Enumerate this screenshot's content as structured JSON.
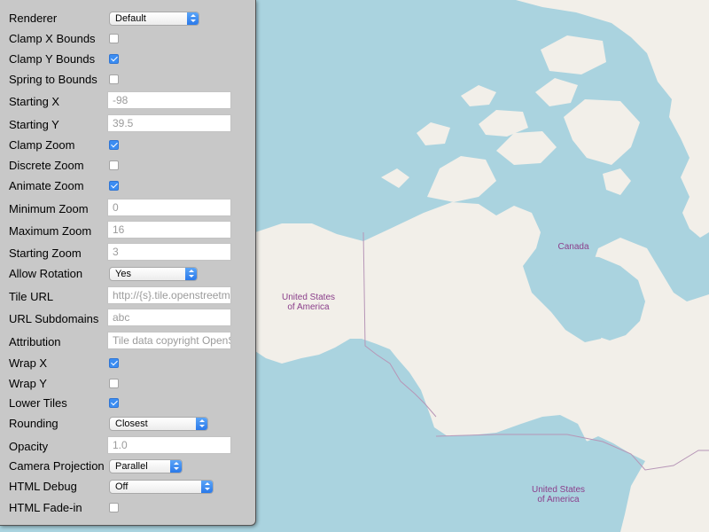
{
  "map": {
    "labels": {
      "canada": "Canada",
      "alaska_line1": "United States",
      "alaska_line2": "of America",
      "us_line1": "United States",
      "us_line2": "of America"
    },
    "colors": {
      "water": "#aad3df",
      "land": "#f2efe9",
      "border": "#b796b7",
      "label": "#8b3f8b"
    }
  },
  "panel": {
    "renderer": {
      "label": "Renderer",
      "value": "Default"
    },
    "clamp_x_bounds": {
      "label": "Clamp X Bounds",
      "checked": false
    },
    "clamp_y_bounds": {
      "label": "Clamp Y Bounds",
      "checked": true
    },
    "spring_to_bounds": {
      "label": "Spring to Bounds",
      "checked": false
    },
    "starting_x": {
      "label": "Starting X",
      "value": "-98"
    },
    "starting_y": {
      "label": "Starting Y",
      "value": "39.5"
    },
    "clamp_zoom": {
      "label": "Clamp Zoom",
      "checked": true
    },
    "discrete_zoom": {
      "label": "Discrete Zoom",
      "checked": false
    },
    "animate_zoom": {
      "label": "Animate Zoom",
      "checked": true
    },
    "minimum_zoom": {
      "label": "Minimum Zoom",
      "value": "0"
    },
    "maximum_zoom": {
      "label": "Maximum Zoom",
      "value": "16"
    },
    "starting_zoom": {
      "label": "Starting Zoom",
      "value": "3"
    },
    "allow_rotation": {
      "label": "Allow Rotation",
      "value": "Yes"
    },
    "tile_url": {
      "label": "Tile URL",
      "value": "http://{s}.tile.openstreetmap.org/{z}/{x}/{y}.png"
    },
    "url_subdomains": {
      "label": "URL Subdomains",
      "value": "abc"
    },
    "attribution": {
      "label": "Attribution",
      "value": "Tile data copyright OpenStreetMap contributors"
    },
    "wrap_x": {
      "label": "Wrap X",
      "checked": true
    },
    "wrap_y": {
      "label": "Wrap Y",
      "checked": false
    },
    "lower_tiles": {
      "label": "Lower Tiles",
      "checked": true
    },
    "rounding": {
      "label": "Rounding",
      "value": "Closest"
    },
    "opacity": {
      "label": "Opacity",
      "value": "1.0"
    },
    "camera_projection": {
      "label": "Camera Projection",
      "value": "Parallel"
    },
    "html_debug": {
      "label": "HTML Debug",
      "value": "Off"
    },
    "html_fade_in": {
      "label": "HTML Fade-in",
      "checked": false
    }
  }
}
